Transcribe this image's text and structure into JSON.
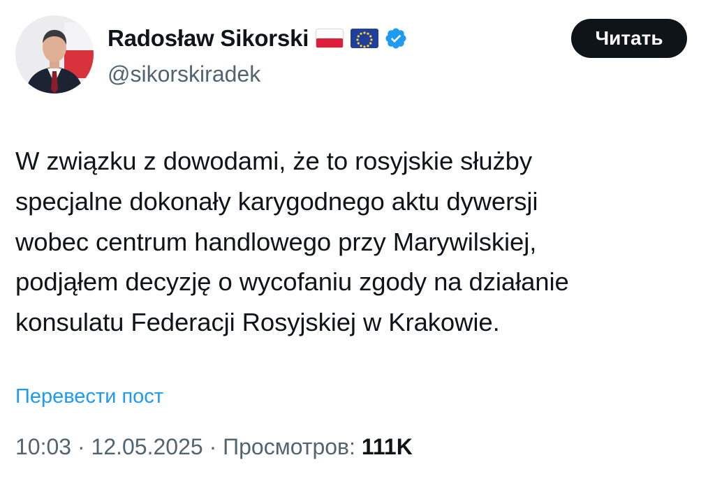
{
  "author": {
    "name": "Radosław Sikorski",
    "handle": "@sikorskiradek",
    "flags": [
      "poland-flag",
      "eu-flag"
    ],
    "verified_icon": "verified-badge-icon",
    "avatar": "avatar"
  },
  "follow_button": {
    "label": "Читать"
  },
  "tweet": {
    "lines": [
      "W związku z dowodami, że to rosyjskie służby",
      "specjalne dokonały karygodnego aktu dywersji",
      "wobec centrum handlowego przy Marywilskiej,",
      "podjąłem decyzję o wycofaniu zgody na działanie",
      "konsulatu Federacji Rosyjskiej w Krakowie."
    ]
  },
  "translate_link": "Перевести пост",
  "meta": {
    "time": "10:03",
    "separator": " · ",
    "date": "12.05.2025",
    "views_label": "Просмотров: ",
    "views_count": "111K"
  },
  "colors": {
    "accent": "#1d9bf0",
    "text": "#0f1419",
    "secondary": "#536471",
    "button_bg": "#0f1419",
    "verified": "#1d9bf0"
  }
}
